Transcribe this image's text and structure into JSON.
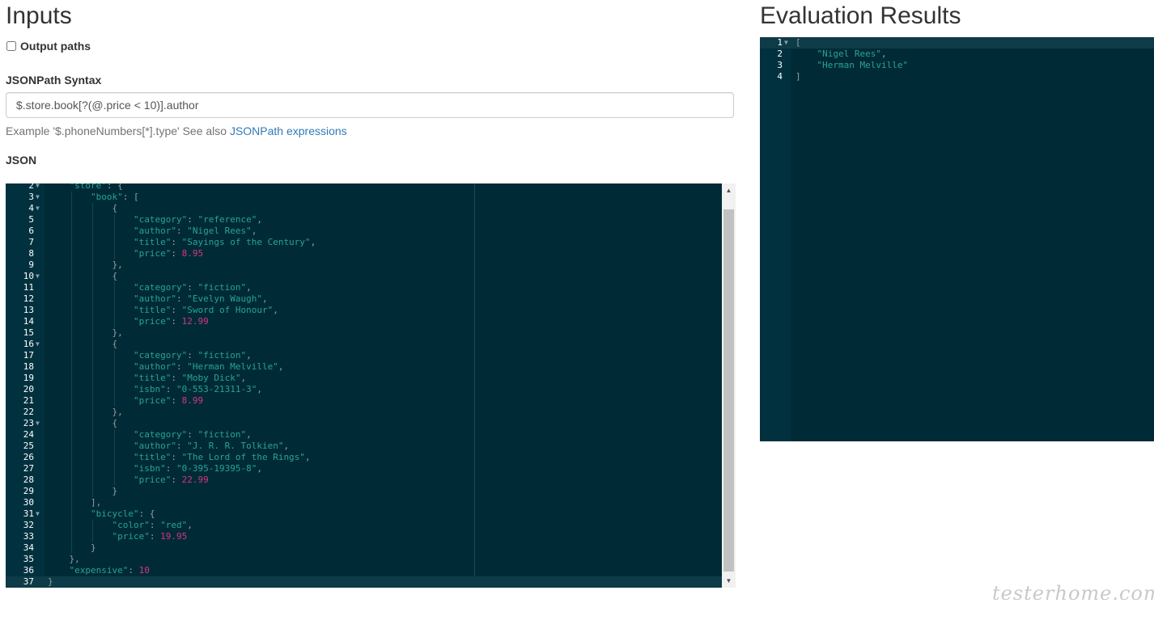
{
  "inputs_title": "Inputs",
  "results_title": "Evaluation Results",
  "output_paths": {
    "label": "Output paths",
    "checked": false
  },
  "syntax": {
    "label": "JSONPath Syntax",
    "value": "$.store.book[?(@.price < 10)].author",
    "help_prefix": "Example '$.phoneNumbers[*].type' See also ",
    "help_link": "JSONPath expressions"
  },
  "json_label": "JSON",
  "json_lines": [
    {
      "n": "2",
      "fold": true,
      "indent": 1,
      "t": [
        [
          "k",
          "\"store\""
        ],
        [
          "p",
          ": {"
        ]
      ]
    },
    {
      "n": "3",
      "fold": true,
      "indent": 2,
      "t": [
        [
          "k",
          "\"book\""
        ],
        [
          "p",
          ": ["
        ]
      ]
    },
    {
      "n": "4",
      "fold": true,
      "indent": 3,
      "t": [
        [
          "p",
          "{"
        ]
      ]
    },
    {
      "n": "5",
      "indent": 4,
      "t": [
        [
          "k",
          "\"category\""
        ],
        [
          "p",
          ": "
        ],
        [
          "s",
          "\"reference\""
        ],
        [
          "p",
          ","
        ]
      ]
    },
    {
      "n": "6",
      "indent": 4,
      "t": [
        [
          "k",
          "\"author\""
        ],
        [
          "p",
          ": "
        ],
        [
          "s",
          "\"Nigel Rees\""
        ],
        [
          "p",
          ","
        ]
      ]
    },
    {
      "n": "7",
      "indent": 4,
      "t": [
        [
          "k",
          "\"title\""
        ],
        [
          "p",
          ": "
        ],
        [
          "s",
          "\"Sayings of the Century\""
        ],
        [
          "p",
          ","
        ]
      ]
    },
    {
      "n": "8",
      "indent": 4,
      "t": [
        [
          "k",
          "\"price\""
        ],
        [
          "p",
          ": "
        ],
        [
          "n",
          "8.95"
        ]
      ]
    },
    {
      "n": "9",
      "indent": 3,
      "t": [
        [
          "p",
          "},"
        ]
      ]
    },
    {
      "n": "10",
      "fold": true,
      "indent": 3,
      "t": [
        [
          "p",
          "{"
        ]
      ]
    },
    {
      "n": "11",
      "indent": 4,
      "t": [
        [
          "k",
          "\"category\""
        ],
        [
          "p",
          ": "
        ],
        [
          "s",
          "\"fiction\""
        ],
        [
          "p",
          ","
        ]
      ]
    },
    {
      "n": "12",
      "indent": 4,
      "t": [
        [
          "k",
          "\"author\""
        ],
        [
          "p",
          ": "
        ],
        [
          "s",
          "\"Evelyn Waugh\""
        ],
        [
          "p",
          ","
        ]
      ]
    },
    {
      "n": "13",
      "indent": 4,
      "t": [
        [
          "k",
          "\"title\""
        ],
        [
          "p",
          ": "
        ],
        [
          "s",
          "\"Sword of Honour\""
        ],
        [
          "p",
          ","
        ]
      ]
    },
    {
      "n": "14",
      "indent": 4,
      "t": [
        [
          "k",
          "\"price\""
        ],
        [
          "p",
          ": "
        ],
        [
          "n",
          "12.99"
        ]
      ]
    },
    {
      "n": "15",
      "indent": 3,
      "t": [
        [
          "p",
          "},"
        ]
      ]
    },
    {
      "n": "16",
      "fold": true,
      "indent": 3,
      "t": [
        [
          "p",
          "{"
        ]
      ]
    },
    {
      "n": "17",
      "indent": 4,
      "t": [
        [
          "k",
          "\"category\""
        ],
        [
          "p",
          ": "
        ],
        [
          "s",
          "\"fiction\""
        ],
        [
          "p",
          ","
        ]
      ]
    },
    {
      "n": "18",
      "indent": 4,
      "t": [
        [
          "k",
          "\"author\""
        ],
        [
          "p",
          ": "
        ],
        [
          "s",
          "\"Herman Melville\""
        ],
        [
          "p",
          ","
        ]
      ]
    },
    {
      "n": "19",
      "indent": 4,
      "t": [
        [
          "k",
          "\"title\""
        ],
        [
          "p",
          ": "
        ],
        [
          "s",
          "\"Moby Dick\""
        ],
        [
          "p",
          ","
        ]
      ]
    },
    {
      "n": "20",
      "indent": 4,
      "t": [
        [
          "k",
          "\"isbn\""
        ],
        [
          "p",
          ": "
        ],
        [
          "s",
          "\"0-553-21311-3\""
        ],
        [
          "p",
          ","
        ]
      ]
    },
    {
      "n": "21",
      "indent": 4,
      "t": [
        [
          "k",
          "\"price\""
        ],
        [
          "p",
          ": "
        ],
        [
          "n",
          "8.99"
        ]
      ]
    },
    {
      "n": "22",
      "indent": 3,
      "t": [
        [
          "p",
          "},"
        ]
      ]
    },
    {
      "n": "23",
      "fold": true,
      "indent": 3,
      "t": [
        [
          "p",
          "{"
        ]
      ]
    },
    {
      "n": "24",
      "indent": 4,
      "t": [
        [
          "k",
          "\"category\""
        ],
        [
          "p",
          ": "
        ],
        [
          "s",
          "\"fiction\""
        ],
        [
          "p",
          ","
        ]
      ]
    },
    {
      "n": "25",
      "indent": 4,
      "t": [
        [
          "k",
          "\"author\""
        ],
        [
          "p",
          ": "
        ],
        [
          "s",
          "\"J. R. R. Tolkien\""
        ],
        [
          "p",
          ","
        ]
      ]
    },
    {
      "n": "26",
      "indent": 4,
      "t": [
        [
          "k",
          "\"title\""
        ],
        [
          "p",
          ": "
        ],
        [
          "s",
          "\"The Lord of the Rings\""
        ],
        [
          "p",
          ","
        ]
      ]
    },
    {
      "n": "27",
      "indent": 4,
      "t": [
        [
          "k",
          "\"isbn\""
        ],
        [
          "p",
          ": "
        ],
        [
          "s",
          "\"0-395-19395-8\""
        ],
        [
          "p",
          ","
        ]
      ]
    },
    {
      "n": "28",
      "indent": 4,
      "t": [
        [
          "k",
          "\"price\""
        ],
        [
          "p",
          ": "
        ],
        [
          "n",
          "22.99"
        ]
      ]
    },
    {
      "n": "29",
      "indent": 3,
      "t": [
        [
          "p",
          "}"
        ]
      ]
    },
    {
      "n": "30",
      "indent": 2,
      "t": [
        [
          "p",
          "],"
        ]
      ]
    },
    {
      "n": "31",
      "fold": true,
      "indent": 2,
      "t": [
        [
          "k",
          "\"bicycle\""
        ],
        [
          "p",
          ": {"
        ]
      ]
    },
    {
      "n": "32",
      "indent": 3,
      "t": [
        [
          "k",
          "\"color\""
        ],
        [
          "p",
          ": "
        ],
        [
          "s",
          "\"red\""
        ],
        [
          "p",
          ","
        ]
      ]
    },
    {
      "n": "33",
      "indent": 3,
      "t": [
        [
          "k",
          "\"price\""
        ],
        [
          "p",
          ": "
        ],
        [
          "n",
          "19.95"
        ]
      ]
    },
    {
      "n": "34",
      "indent": 2,
      "t": [
        [
          "p",
          "}"
        ]
      ]
    },
    {
      "n": "35",
      "indent": 1,
      "t": [
        [
          "p",
          "},"
        ]
      ]
    },
    {
      "n": "36",
      "indent": 1,
      "t": [
        [
          "k",
          "\"expensive\""
        ],
        [
          "p",
          ": "
        ],
        [
          "n",
          "10"
        ]
      ]
    },
    {
      "n": "37",
      "indent": 0,
      "active": true,
      "t": [
        [
          "p",
          "}"
        ]
      ]
    }
  ],
  "result_lines": [
    {
      "n": "1",
      "fold": true,
      "indent": 0,
      "active": true,
      "t": [
        [
          "p",
          "["
        ]
      ]
    },
    {
      "n": "2",
      "indent": 1,
      "t": [
        [
          "s",
          "\"Nigel Rees\""
        ],
        [
          "p",
          ","
        ]
      ]
    },
    {
      "n": "3",
      "indent": 1,
      "t": [
        [
          "s",
          "\"Herman Melville\""
        ]
      ]
    },
    {
      "n": "4",
      "indent": 0,
      "t": [
        [
          "p",
          "]"
        ]
      ]
    }
  ],
  "watermark": "testerhome.com",
  "icons": {
    "fold": "fold-arrow-icon",
    "scroll_up": "scroll-up-arrow-icon",
    "scroll_down": "scroll-down-arrow-icon"
  },
  "colors": {
    "editor_bg": "#002b36",
    "gutter_bg": "#01313f",
    "string": "#2aa198",
    "number": "#d33682",
    "link": "#337ab7"
  }
}
